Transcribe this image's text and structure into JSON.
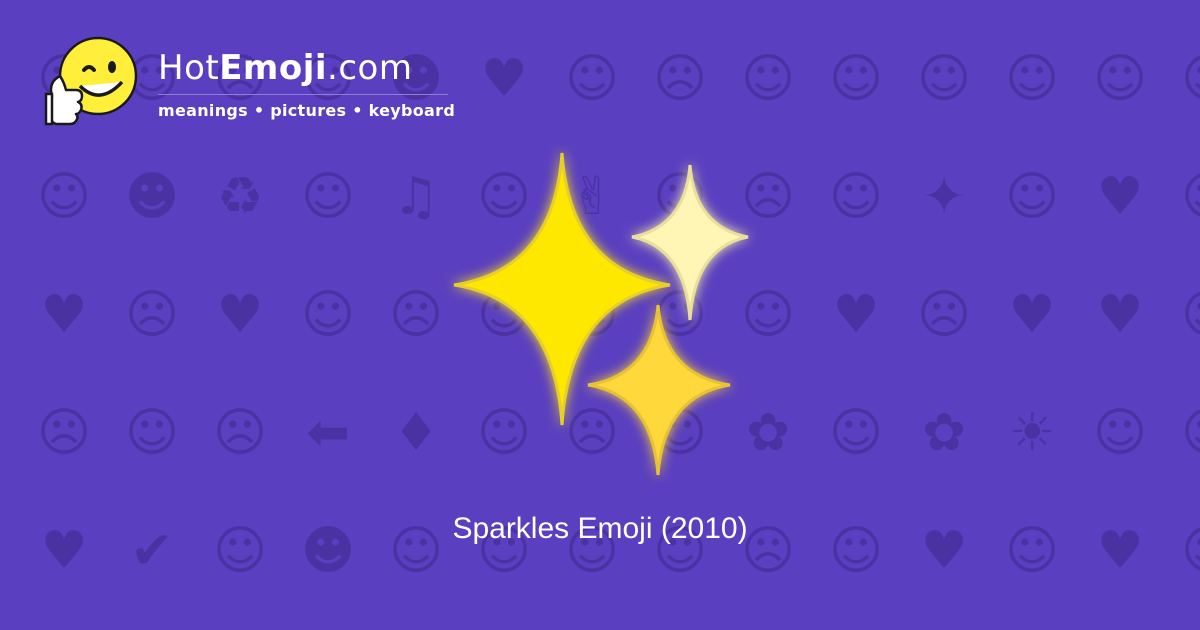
{
  "brand": {
    "name_part1": "Hot",
    "name_part2": "Emoji",
    "name_part3": ".com",
    "tagline": "meanings • pictures • keyboard",
    "logo_icon": "thumbs-up-winking-face-icon"
  },
  "hero": {
    "icon": "sparkles-icon",
    "caption": "Sparkles Emoji (2010)"
  },
  "background_pattern": [
    "☺",
    "☺",
    "☹",
    "☺",
    "☻",
    "♥",
    "☺",
    "☹",
    "☺",
    "☺",
    "☺",
    "☺",
    "☺",
    "☺",
    "☺",
    "☻",
    "♻",
    "☺",
    "♫",
    "☺",
    "✌",
    "☺",
    "☹",
    "☺",
    "✦",
    "☺",
    "♥",
    "☺",
    "♥",
    "☹",
    "♥",
    "☺",
    "☹",
    "☺",
    "☺",
    "☺",
    "☺",
    "♥",
    "☹",
    "♥",
    "♥",
    "☺",
    "☹",
    "☺",
    "☹",
    "⬅",
    "♦",
    "☺",
    "☹",
    "☺",
    "✿",
    "☺",
    "✿",
    "☀",
    "☺",
    "☺",
    "♥",
    "✔",
    "☺",
    "☻",
    "☺",
    "☺",
    "☺",
    "☺",
    "☹",
    "☺",
    "♥",
    "☺",
    "♥",
    "☺"
  ],
  "colors": {
    "background": "#5a3fc0",
    "pattern": "#4a32a3",
    "sparkle_large": "#ffe800",
    "sparkle_small_top": "#fff5b5",
    "sparkle_small_bottom": "#ffd83a"
  }
}
